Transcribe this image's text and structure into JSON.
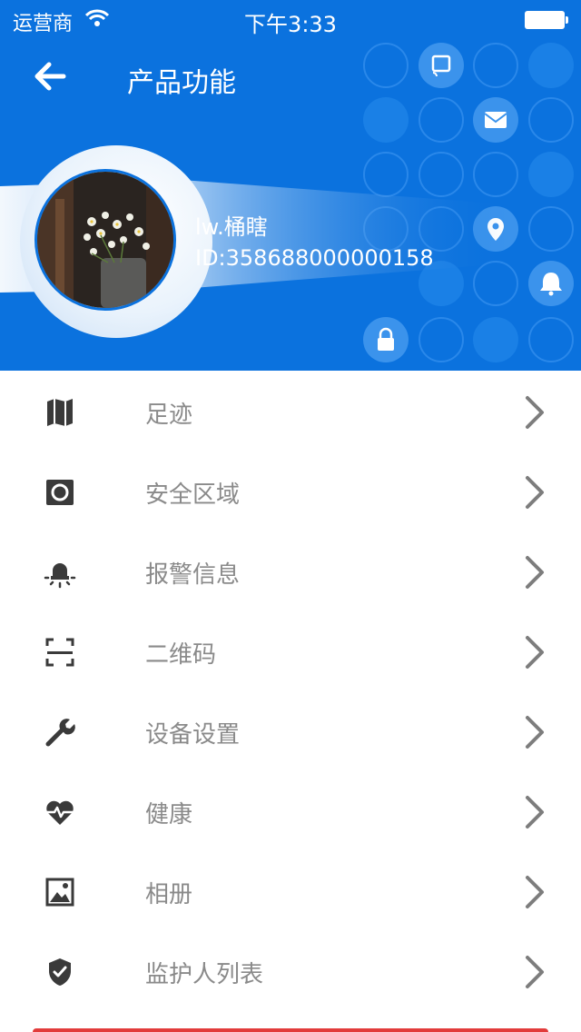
{
  "status_bar": {
    "carrier": "运营商",
    "time": "下午3:33"
  },
  "header": {
    "title": "产品功能"
  },
  "profile": {
    "name": "lw.桶瞎",
    "id": "ID:358688000000158"
  },
  "menu": {
    "items": [
      {
        "label": "足迹",
        "icon": "map-icon"
      },
      {
        "label": "安全区域",
        "icon": "safe-zone-icon"
      },
      {
        "label": "报警信息",
        "icon": "alarm-light-icon"
      },
      {
        "label": "二维码",
        "icon": "qr-scan-icon"
      },
      {
        "label": "设备设置",
        "icon": "wrench-icon"
      },
      {
        "label": "健康",
        "icon": "heartbeat-icon"
      },
      {
        "label": "相册",
        "icon": "photo-album-icon"
      },
      {
        "label": "监护人列表",
        "icon": "shield-check-icon"
      }
    ]
  },
  "colors": {
    "header_bg": "#0b72de",
    "label": "#8a8a8a",
    "icon": "#3a3a3a",
    "chevron": "#7d7d7d"
  }
}
